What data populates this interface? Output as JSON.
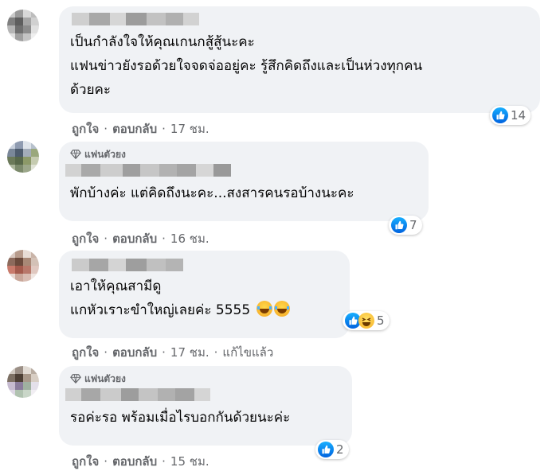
{
  "comments": [
    {
      "fan_badge": "",
      "lines": [
        "เป็นกำลังใจให้คุณเกนกสู้สู้นะคะ",
        "แฟนข่าวยังรอด้วยใจจดจ่ออยู่คะ รู้สึกคิดถึงและเป็นห่วงทุกคน",
        "ด้วยคะ"
      ],
      "reaction_count": "14",
      "like_label": "ถูกใจ",
      "reply_label": "ตอบกลับ",
      "time": "17 ชม.",
      "edited": ""
    },
    {
      "fan_badge": "แฟนตัวยง",
      "lines": [
        "พักบ้างค่ะ แต่คิดถึงนะคะ...สงสารคนรอบ้างนะคะ"
      ],
      "reaction_count": "7",
      "like_label": "ถูกใจ",
      "reply_label": "ตอบกลับ",
      "time": "16 ชม.",
      "edited": ""
    },
    {
      "fan_badge": "",
      "lines": [
        "เอาให้คุณสามีดู",
        "แกหัวเราะขำใหญ่เลยค่ะ 5555"
      ],
      "reaction_count": "5",
      "like_label": "ถูกใจ",
      "reply_label": "ตอบกลับ",
      "time": "17 ชม.",
      "edited": "แก้ไขแล้ว"
    },
    {
      "fan_badge": "แฟนตัวยง",
      "lines": [
        "รอค่ะรอ พร้อมเมื่อไรบอกกันด้วยนะค่ะ"
      ],
      "reaction_count": "2",
      "like_label": "ถูกใจ",
      "reply_label": "ตอบกลับ",
      "time": "15 ชม.",
      "edited": ""
    }
  ],
  "colors": {
    "bubble": "#f0f2f5",
    "meta_text": "#65676b",
    "like_blue": "#1877f2"
  },
  "icons": [
    "diamond-icon",
    "like-icon",
    "haha-icon",
    "laughing-emoji"
  ]
}
